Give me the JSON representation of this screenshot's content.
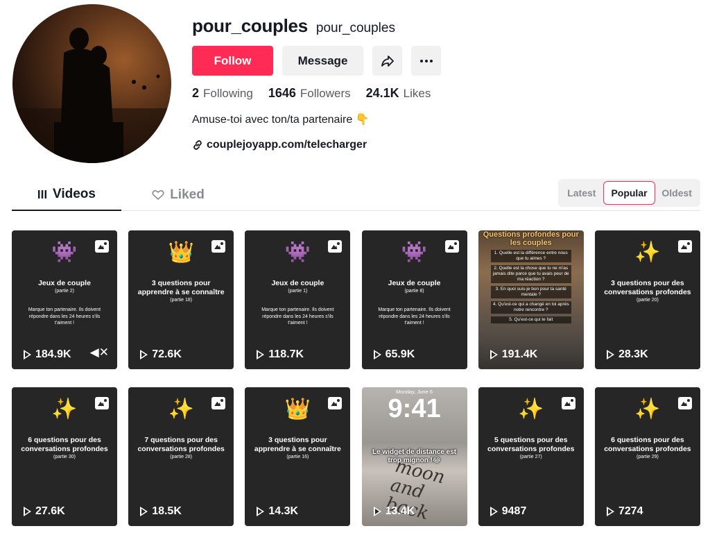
{
  "profile": {
    "handle": "pour_couples",
    "nickname": "pour_couples",
    "follow_label": "Follow",
    "message_label": "Message",
    "following_count": "2",
    "following_label": "Following",
    "followers_count": "1646",
    "followers_label": "Followers",
    "likes_count": "24.1K",
    "likes_label": "Likes",
    "bio": "Amuse-toi avec ton/ta partenaire 👇",
    "link": "couplejoyapp.com/telecharger"
  },
  "tabs": {
    "videos": "Videos",
    "liked": "Liked"
  },
  "sort": {
    "latest": "Latest",
    "popular": "Popular",
    "oldest": "Oldest",
    "active": "Popular"
  },
  "videos": [
    {
      "emoji": "👾",
      "title": "Jeux de couple",
      "part": "(partie 2)",
      "desc": "Marque ton partenaire. Ils doivent répondre dans les 24 heures s'ils t'aiment !",
      "views": "184.9K",
      "muted": true
    },
    {
      "emoji": "👑",
      "title": "3 questions pour apprendre à se connaître",
      "part": "(partie 18)",
      "desc": "",
      "views": "72.6K"
    },
    {
      "emoji": "👾",
      "title": "Jeux de couple",
      "part": "(partie 1)",
      "desc": "Marque ton partenaire. Ils doivent répondre dans les 24 heures s'ils t'aiment !",
      "views": "118.7K"
    },
    {
      "emoji": "👾",
      "title": "Jeux de couple",
      "part": "(partie 8)",
      "desc": "Marque ton partenaire. Ils doivent répondre dans les 24 heures s'ils t'aiment !",
      "views": "65.9K"
    },
    {
      "photo_title": "Questions profondes pour les couples",
      "questions": [
        "1. Quelle est la différence entre nous que tu aimes ?",
        "2. Quelle est la chose que tu ne m'as jamais dite parce que tu avais peur de ma réaction ?",
        "3. En quoi suis-je bon pour ta santé mentale ?",
        "4. Qu'est-ce qui a changé en toi après notre rencontre ?",
        "5. Qu'est-ce qui te fait"
      ],
      "views": "191.4K"
    },
    {
      "emoji": "✨",
      "title": "3 questions pour des conversations profondes",
      "part": "(partie 20)",
      "desc": "",
      "views": "28.3K"
    },
    {
      "emoji": "✨",
      "title": "6 questions pour des conversations profondes",
      "part": "(partie 30)",
      "desc": "",
      "views": "27.6K"
    },
    {
      "emoji": "✨",
      "title": "7 questions pour des conversations profondes",
      "part": "(partie 28)",
      "desc": "",
      "views": "18.5K"
    },
    {
      "emoji": "👑",
      "title": "3 questions pour apprendre à se connaître",
      "part": "(partie 16)",
      "desc": "",
      "views": "14.3K"
    },
    {
      "lock_date": "Monday, June 6",
      "lock_time": "9:41",
      "caption": "Le widget de distance est trop mignon !😂",
      "writing": "moon and back",
      "views": "13.4K"
    },
    {
      "emoji": "✨",
      "title": "5 questions pour des conversations profondes",
      "part": "(partie 27)",
      "desc": "",
      "views": "9487"
    },
    {
      "emoji": "✨",
      "title": "6 questions pour des conversations profondes",
      "part": "(partie 29)",
      "desc": "",
      "views": "7274"
    }
  ]
}
